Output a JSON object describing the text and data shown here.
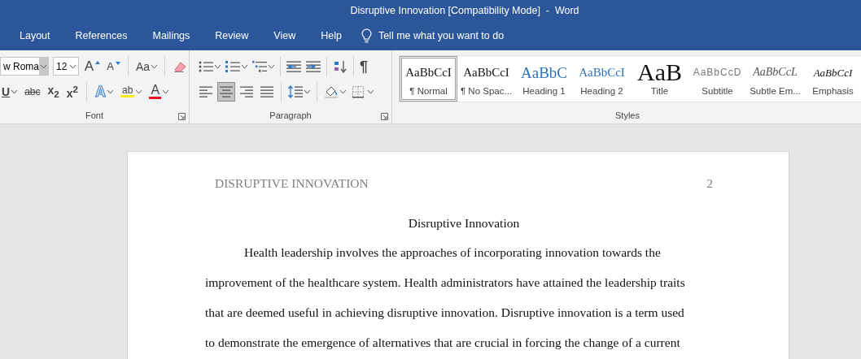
{
  "window": {
    "title": "Disruptive Innovation [Compatibility Mode]  -  Word"
  },
  "tabs": [
    {
      "label": "Layout",
      "selected": false
    },
    {
      "label": "References",
      "selected": false
    },
    {
      "label": "Mailings",
      "selected": false
    },
    {
      "label": "Review",
      "selected": false
    },
    {
      "label": "View",
      "selected": false
    },
    {
      "label": "Help",
      "selected": false
    }
  ],
  "tell_me": {
    "placeholder": "Tell me what you want to do"
  },
  "font_group": {
    "label": "Font",
    "font_name": "w Roma",
    "font_size": "12",
    "row1": [
      {
        "kind": "grow",
        "label": "A",
        "dropdown": false
      },
      {
        "kind": "shrink",
        "label": "A",
        "dropdown": false
      },
      {
        "kind": "divider"
      },
      {
        "kind": "case",
        "label": "Aa",
        "dropdown": true
      },
      {
        "kind": "divider"
      },
      {
        "kind": "clear",
        "dropdown": false
      }
    ],
    "row2": [
      {
        "kind": "underline",
        "label": "U",
        "dropdown": true
      },
      {
        "kind": "strike",
        "label": "abc",
        "dropdown": false
      },
      {
        "kind": "subscript",
        "label": "x$_{2}$",
        "dropdown": false
      },
      {
        "kind": "superscript",
        "label": "x$^{2}$",
        "dropdown": false
      },
      {
        "kind": "divider"
      },
      {
        "kind": "effects",
        "label": "A",
        "dropdown": true
      },
      {
        "kind": "highlight",
        "label": "ab",
        "dropdown": true
      },
      {
        "kind": "fontcolor",
        "label": "A",
        "dropdown": true
      }
    ]
  },
  "paragraph_group": {
    "label": "Paragraph",
    "row1": [
      {
        "kind": "bullets",
        "dropdown": true
      },
      {
        "kind": "numbering",
        "dropdown": true
      },
      {
        "kind": "multilevel",
        "dropdown": true
      },
      {
        "kind": "divider"
      },
      {
        "kind": "outdent",
        "dropdown": false
      },
      {
        "kind": "indent",
        "dropdown": false
      },
      {
        "kind": "divider"
      },
      {
        "kind": "sort",
        "dropdown": false
      },
      {
        "kind": "divider"
      },
      {
        "kind": "pilcrow",
        "label": "¶",
        "dropdown": false
      }
    ],
    "row2": [
      {
        "kind": "align_left",
        "dropdown": false,
        "selected": false
      },
      {
        "kind": "align_center",
        "dropdown": false,
        "selected": true
      },
      {
        "kind": "align_right",
        "dropdown": false,
        "selected": false
      },
      {
        "kind": "justify",
        "dropdown": false,
        "selected": false
      },
      {
        "kind": "divider"
      },
      {
        "kind": "spacing",
        "dropdown": true
      },
      {
        "kind": "divider"
      },
      {
        "kind": "shading",
        "dropdown": true
      },
      {
        "kind": "borders",
        "dropdown": true
      }
    ]
  },
  "styles_group": {
    "label": "Styles",
    "items": [
      {
        "preview": "AaBbCcI",
        "name": "¶ Normal",
        "kind": "normal",
        "selected": true
      },
      {
        "preview": "AaBbCcI",
        "name": "¶ No Spac...",
        "kind": "normal",
        "selected": false
      },
      {
        "preview": "AaBbC",
        "name": "Heading 1",
        "kind": "heading1",
        "selected": false
      },
      {
        "preview": "AaBbCcI",
        "name": "Heading 2",
        "kind": "heading2",
        "selected": false
      },
      {
        "preview": "AaB",
        "name": "Title",
        "kind": "title",
        "selected": false
      },
      {
        "preview": "AaBbCcD",
        "name": "Subtitle",
        "kind": "subtitle",
        "selected": false
      },
      {
        "preview": "AaBbCcL",
        "name": "Subtle Em...",
        "kind": "subtle",
        "selected": false
      },
      {
        "preview": "AaBbCcI",
        "name": "Emphasis",
        "kind": "emphasis",
        "selected": false
      }
    ]
  },
  "document": {
    "header": "DISRUPTIVE INNOVATION",
    "page_number": "2",
    "title": "Disruptive Innovation",
    "lines": [
      {
        "text": "Health leadership involves the approaches of incorporating innovation towards the",
        "indent": true
      },
      {
        "text": "improvement of the healthcare system. Health administrators have attained the leadership traits",
        "indent": false
      },
      {
        "text": "that are deemed useful in achieving disruptive innovation. Disruptive innovation is a term used",
        "indent": false
      },
      {
        "text": "to demonstrate the emergence of alternatives that are crucial in forcing the change of a current",
        "indent": false
      }
    ]
  }
}
